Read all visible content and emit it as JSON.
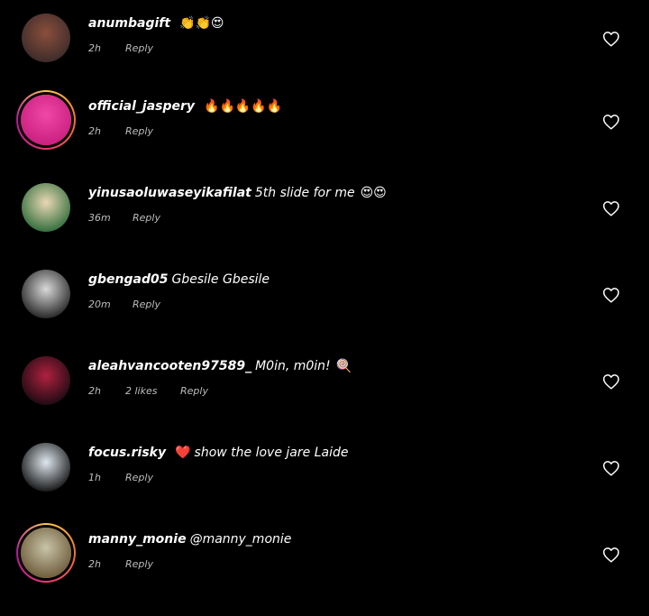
{
  "comments": [
    {
      "user": "anumbagift",
      "text": "",
      "emoji": "👏👏😍",
      "time": "2h",
      "likes": "",
      "reply": "Reply",
      "story_ring": false,
      "avatar_colors": [
        "#8a4f3c",
        "#3b2a2a"
      ]
    },
    {
      "user": "official_jaspery",
      "text": "",
      "emoji": "🔥🔥🔥🔥🔥",
      "time": "2h",
      "likes": "",
      "reply": "Reply",
      "story_ring": true,
      "avatar_colors": [
        "#f048a8",
        "#c81e7d"
      ]
    },
    {
      "user": "yinusaoluwaseyikafilat",
      "text": "5th slide for me",
      "emoji": "😍😍",
      "time": "36m",
      "likes": "",
      "reply": "Reply",
      "story_ring": false,
      "avatar_colors": [
        "#e9d8b4",
        "#2e6b3a"
      ]
    },
    {
      "user": "gbengad05",
      "text": "Gbesile Gbesile",
      "emoji": "",
      "time": "20m",
      "likes": "",
      "reply": "Reply",
      "story_ring": false,
      "avatar_colors": [
        "#d9d9d9",
        "#222222"
      ]
    },
    {
      "user": "aleahvancooten97589_",
      "text": "M0in, m0in!",
      "emoji": "🍭",
      "time": "2h",
      "likes": "2 likes",
      "reply": "Reply",
      "story_ring": false,
      "avatar_colors": [
        "#b0213f",
        "#1a0a12"
      ]
    },
    {
      "user": "focus.risky",
      "text": "show the love jare Laide",
      "emoji": "❤️",
      "time": "1h",
      "likes": "",
      "reply": "Reply",
      "story_ring": false,
      "avatar_colors": [
        "#dfe8ef",
        "#111111"
      ]
    },
    {
      "user": "manny_monie",
      "text": "@manny_monie",
      "emoji": "",
      "time": "2h",
      "likes": "",
      "reply": "Reply",
      "story_ring": true,
      "avatar_colors": [
        "#c9c3a8",
        "#6b5a38"
      ]
    }
  ]
}
